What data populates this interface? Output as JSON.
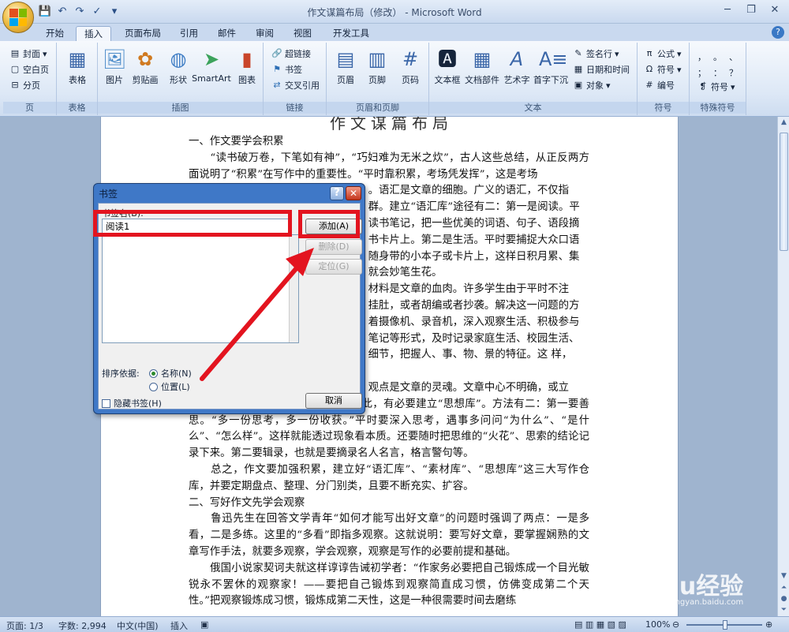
{
  "window": {
    "title": "作文谋篇布局（修改） - Microsoft Word"
  },
  "tabs": [
    "开始",
    "插入",
    "页面布局",
    "引用",
    "邮件",
    "审阅",
    "视图",
    "开发工具"
  ],
  "active_tab": "插入",
  "ribbon": {
    "pages": {
      "label": "页",
      "cover": "封面",
      "blank": "空白页",
      "break": "分页"
    },
    "table": {
      "label": "表格",
      "btn": "表格"
    },
    "illustrations": {
      "label": "插图",
      "picture": "图片",
      "clipart": "剪贴画",
      "shapes": "形状",
      "smartart": "SmartArt",
      "chart": "图表"
    },
    "links": {
      "label": "链接",
      "hyperlink": "超链接",
      "bookmark": "书签",
      "crossref": "交叉引用"
    },
    "header_footer": {
      "label": "页眉和页脚",
      "header": "页眉",
      "footer": "页脚",
      "page_number": "页码"
    },
    "text": {
      "label": "文本",
      "textbox": "文本框",
      "quickparts": "文档部件",
      "wordart": "艺术字",
      "dropcap": "首字下沉",
      "signature": "签名行",
      "datetime": "日期和时间",
      "object": "对象"
    },
    "symbols": {
      "label": "符号",
      "equation": "公式",
      "symbol": "符号",
      "number": "编号"
    },
    "special": {
      "label": "特殊符号",
      "symbol": "符号",
      "chars": [
        "，",
        "。",
        "、",
        "；",
        "：",
        "？"
      ]
    }
  },
  "document": {
    "top_partial": "作文谋篇布局",
    "paragraphs": [
      "一、作文要学会积累",
      "　　“读书破万卷，下笔如有神”，“巧妇难为无米之炊”，古人这些总结，从正反两方面说明了“积累”在写作中的重要性。“平时靠积累，考场凭发挥”，这是考场",
      "　　　　　　　　　　　　　　　　　。语汇是文章的细胞。广义的语汇，不仅指",
      "　　　　　　　　　　　　　　　　　群。建立“语汇库”途径有二：第一是阅读。平",
      "　　　　　　　　　　　　　　　　　读书笔记，把一些优美的词语、句子、语段摘",
      "　　　　　　　　　　　　　　　　　书卡片上。第二是生活。平时要捕捉大众口语",
      "　　　　　　　　　　　　　　　　　随身带的小本子或卡片上，这样日积月累、集",
      "　　　　　　　　　　　　　　　　　就会妙笔生花。",
      "　　　　　　　　　　　　　　　　　材料是文章的血肉。许多学生由于平时不注",
      "　　　　　　　　　　　　　　　　　挂肚，或者胡编或者抄袭。解决这一问题的方",
      "　　　　　　　　　　　　　　　　　着摄像机、录音机，深入观察生活、积极参与",
      "　　　　　　　　　　　　　　　　　笔记等形式，及时记录家庭生活、校园生活、",
      "　　　　　　　　　　　　　　　　　细节，把握人、事、物、景的特征。这 样，",
      "",
      "　　　　　　　　　　　　　　　　　观点是文章的灵魂。文章中心不明确，或立",
      "意不深刻，往往是作者思想肤浅。因此，有必要建立“思想库”。方法有二：第一要善思。“多一份思考，多一份收获。”平时要深入思考，遇事多问问“为什么”、“是什么”、“怎么样”。这样就能透过现象看本质。还要随时把思维的“火花”、思索的结论记录下来。第二要辑录，也就是要摘录名人名言，格言警句等。",
      "　　总之，作文要加强积累，建立好“语汇库”、“素材库”、“思想库”这三大写作仓库，并要定期盘点、整理、分门别类，且要不断充实、扩容。",
      "二、写好作文先学会观察",
      "　　鲁迅先生在回答文学青年“如何才能写出好文章”的问题时强调了两点：一是多看，二是多练。这里的“多看”即指多观察。这就说明：要写好文章，要掌握娴熟的文章写作手法，就要多观察，学会观察，观察是写作的必要前提和基础。",
      "　　俄国小说家契诃夫就这样谆谆告诫初学者：“作家务必要把自己锻炼成一个目光敏锐永不罢休的观察家！——要把自己锻炼到观察简直成习惯，仿佛变成第二个天性。”把观察锻炼成习惯，锻炼成第二天性，这是一种很需要时间去磨练"
    ]
  },
  "dialog": {
    "title": "书签",
    "name_label": "书签名(B):",
    "name_value": "阅读1",
    "add": "添加(A)",
    "delete": "删除(D)",
    "goto": "定位(G)",
    "sort_label": "排序依据:",
    "sort_name": "名称(N)",
    "sort_position": "位置(L)",
    "hidden": "隐藏书签(H)",
    "cancel": "取消"
  },
  "status": {
    "page": "页面: 1/3",
    "words": "字数: 2,994",
    "lang": "中文(中国)",
    "mode": "插入",
    "zoom": "100%"
  },
  "watermark": {
    "brand": "Baidu经验",
    "url": "jingyan.baidu.com"
  },
  "colors": {
    "highlight": "#e3141f",
    "ribbon_blue": "#c9d9ef",
    "dialog_frame": "#3f78c7"
  }
}
